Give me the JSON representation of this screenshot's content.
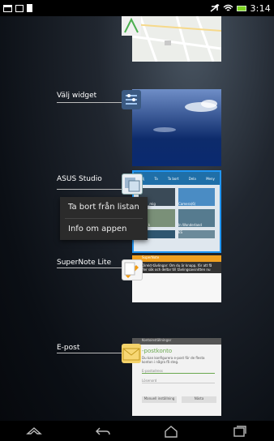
{
  "status": {
    "time": "3:14",
    "battery_color": "#7ed321"
  },
  "recents": [
    {
      "label": "",
      "app": "Maps"
    },
    {
      "label": "Välj widget"
    },
    {
      "label": "ASUS Studio"
    },
    {
      "label": "SuperNote Lite"
    },
    {
      "label": "E-post"
    }
  ],
  "context_menu": {
    "remove": "Ta bort från listan",
    "info": "Info om appen"
  },
  "studio": {
    "toolbar": [
      "Välj",
      "Ta",
      "Ta bort",
      "Dela",
      "Meny"
    ],
    "tiles": [
      "Cp_ta_mig",
      "Camera(6)",
      "Ta_in_k",
      "In Wonderland",
      "ASUS",
      "ES"
    ]
  },
  "supernote": {
    "header": "SuperNote",
    "body": "Direkt-tävlingar: Om du är knapp, för att få fler sök och deltar till tävlingsavsnitten nu"
  },
  "epost": {
    "header": "Kontoinställningar",
    "title": "-postkonto",
    "desc": "Du kan konfigurera e-post för de flesta konton i några få steg.",
    "field1": "E-postadress",
    "field2": "Lösenord",
    "btn1": "Manuell inställning",
    "btn2": "Nästa"
  },
  "nav": {
    "icons": [
      "up-icon",
      "back-icon",
      "home-icon",
      "recent-apps-icon"
    ]
  }
}
